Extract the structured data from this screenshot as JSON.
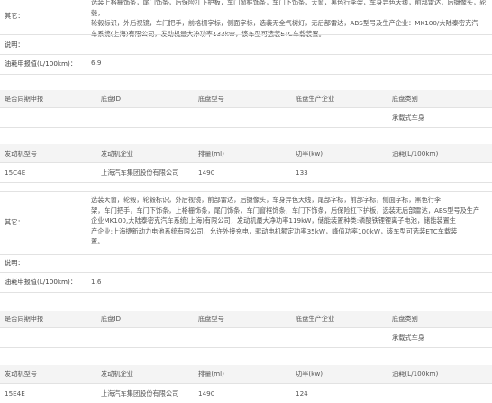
{
  "block1": {
    "other_label": "其它：",
    "other_text": "选装上格栅饰条，尾门饰条，后保险杠下护板，车门窗框饰条，车门下饰条，天窗，黑色行李架，车身异色天线，前部雷达，后摄像头，轮毂，\n轮毂标识，外后视镜，车门把手，前格栅字标，侧面字标，选装无全气树灯，无后部雷达，ABS型号及生产企业：MK100/大陆泰密克汽\n车系统(上海)有限公司，发动机最大净功率133kW，该车型可选装ETC车载装置。",
    "note_label": "说明：",
    "note_value": "",
    "fuel_label": "油耗申报值(L/100km)：",
    "fuel_value": "6.9"
  },
  "chassis1": {
    "headers": [
      "是否同期申报",
      "底盘ID",
      "底盘型号",
      "底盘生产企业",
      "底盘类别"
    ],
    "values": [
      "",
      "",
      "",
      "",
      "承载式车身"
    ]
  },
  "engine1": {
    "headers": [
      "发动机型号",
      "发动机企业",
      "排量(ml)",
      "功率(kw)",
      "油耗(L/100km)"
    ],
    "values": [
      "15C4E",
      "上海汽车集团股份有限公司",
      "1490",
      "133",
      ""
    ]
  },
  "block2": {
    "other_label": "其它：",
    "other_text": "选装天窗，轮毂，轮毂标识，外后视镜，前部雷达，后摄像头，车身异色天线，尾部字标，前部字标，侧面字标，黑色行李\n架，车门把手，车门下饰条，上格栅饰条，尾门饰条，车门窗框饰条，车门下饰条，后保险杠下护板，选装无后部雷达，ABS型号及生产\n企业MK100,大陆泰密克汽车系统(上海)有限公司，发动机最大净功率119kW，储能装置种类:磷酸铁锂锂离子电池，储能装置生\n产企业:上海捷新动力电池系统有限公司，允许外接充电，驱动电机额定功率35kW，峰值功率100kW，该车型可选装ETC车载装\n置。",
    "note_label": "说明：",
    "note_value": "",
    "fuel_label": "油耗申报值(L/100km)：",
    "fuel_value": "1.6"
  },
  "chassis2": {
    "headers": [
      "是否同期申报",
      "底盘ID",
      "底盘型号",
      "底盘生产企业",
      "底盘类别"
    ],
    "values": [
      "",
      "",
      "",
      "",
      "承载式车身"
    ]
  },
  "engine2": {
    "headers": [
      "发动机型号",
      "发动机企业",
      "排量(ml)",
      "功率(kw)",
      "油耗(L/100km)"
    ],
    "values": [
      "15E4E",
      "上海汽车集团股份有限公司",
      "1490",
      "124",
      ""
    ]
  }
}
